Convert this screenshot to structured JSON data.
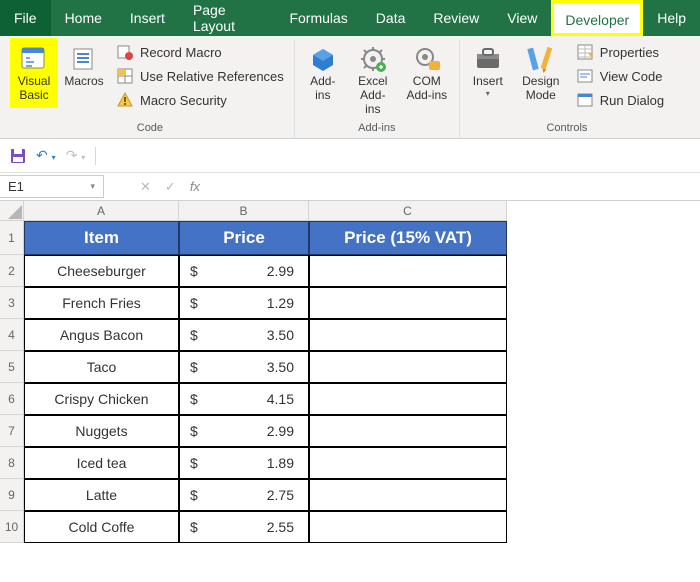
{
  "menu": {
    "file": "File",
    "home": "Home",
    "insert": "Insert",
    "page_layout": "Page Layout",
    "formulas": "Formulas",
    "data": "Data",
    "review": "Review",
    "view": "View",
    "developer": "Developer",
    "help": "Help"
  },
  "ribbon": {
    "code": {
      "vb": "Visual\nBasic",
      "macros": "Macros",
      "record": "Record Macro",
      "relref": "Use Relative References",
      "security": "Macro Security",
      "group": "Code"
    },
    "addins": {
      "addins": "Add-\nins",
      "excel_addins": "Excel\nAdd-ins",
      "com_addins": "COM\nAdd-ins",
      "group": "Add-ins"
    },
    "controls": {
      "insert": "Insert",
      "design": "Design\nMode",
      "properties": "Properties",
      "view_code": "View Code",
      "run_dialog": "Run Dialog",
      "group": "Controls"
    }
  },
  "namebox": "E1",
  "formula": "",
  "columns": [
    "A",
    "B",
    "C"
  ],
  "headers": [
    "Item",
    "Price",
    "Price (15% VAT)"
  ],
  "rows": [
    {
      "item": "Cheeseburger",
      "cur": "$",
      "price": "2.99"
    },
    {
      "item": "French Fries",
      "cur": "$",
      "price": "1.29"
    },
    {
      "item": "Angus Bacon",
      "cur": "$",
      "price": "3.50"
    },
    {
      "item": "Taco",
      "cur": "$",
      "price": "3.50"
    },
    {
      "item": "Crispy Chicken",
      "cur": "$",
      "price": "4.15"
    },
    {
      "item": "Nuggets",
      "cur": "$",
      "price": "2.99"
    },
    {
      "item": "Iced tea",
      "cur": "$",
      "price": "1.89"
    },
    {
      "item": "Latte",
      "cur": "$",
      "price": "2.75"
    },
    {
      "item": "Cold Coffe",
      "cur": "$",
      "price": "2.55"
    }
  ],
  "row_nums": [
    "1",
    "2",
    "3",
    "4",
    "5",
    "6",
    "7",
    "8",
    "9",
    "10"
  ]
}
